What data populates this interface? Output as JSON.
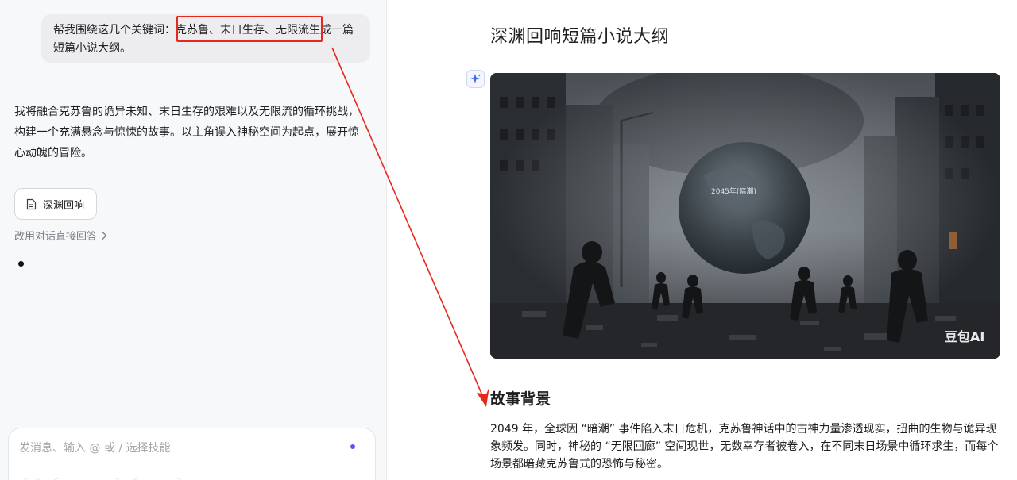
{
  "chat": {
    "user_message_prefix": "帮我围绕这几个关键词：",
    "user_message_keywords": "克苏鲁、末日生存、无限流",
    "user_message_suffix": "生成一篇短篇小说大纲。",
    "assistant_reply": "我将融合克苏鲁的诡异未知、末日生存的艰难以及无限流的循环挑战，构建一个充满悬念与惊悚的故事。以主角误入神秘空间为起点，展开惊心动魄的冒险。",
    "doc_chip_label": "深渊回响",
    "switch_link": "改用对话直接回答",
    "input_placeholder": "发消息、输入 @ 或 / 选择技能"
  },
  "document": {
    "title": "深渊回响短篇小说大纲",
    "image_caption": "2045年(暗潮)",
    "image_watermark": "豆包AI",
    "section_heading": "故事背景",
    "paragraph": "2049 年，全球因 “暗潮” 事件陷入末日危机，克苏鲁神话中的古神力量渗透现实，扭曲的生物与诡异现象频发。同时，神秘的 “无限回廊” 空间现世，无数幸存者被卷入，在不同末日场景中循环求生，而每个场景都暗藏克苏鲁式的恐怖与秘密。"
  },
  "icons": {
    "doc": "document-icon",
    "chevron": "chevron-right-icon",
    "ai": "sparkle-icon"
  },
  "colors": {
    "annotation_red": "#e5291f",
    "accent_purple": "#6a4cf5"
  }
}
